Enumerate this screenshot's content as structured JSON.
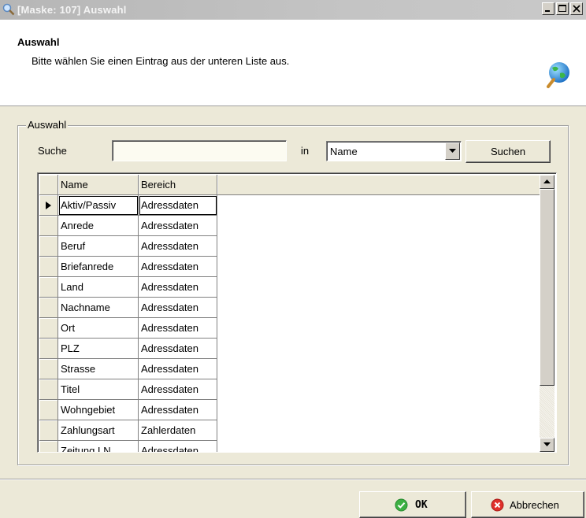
{
  "window": {
    "title": "[Maske: 107]  Auswahl",
    "controls": [
      "minimize-icon",
      "maximize-icon",
      "close-icon"
    ]
  },
  "header": {
    "title": "Auswahl",
    "subtitle": "Bitte wählen Sie einen Eintrag aus der unteren Liste aus.",
    "icon": "globe-search-icon"
  },
  "group": {
    "legend": "Auswahl"
  },
  "search": {
    "label": "Suche",
    "value": "",
    "in_label": "in",
    "field_selected": "Name",
    "button_label": "Suchen"
  },
  "table": {
    "columns": [
      "Name",
      "Bereich"
    ],
    "rows": [
      {
        "name": "Aktiv/Passiv",
        "bereich": "Adressdaten"
      },
      {
        "name": "Anrede",
        "bereich": "Adressdaten"
      },
      {
        "name": "Beruf",
        "bereich": "Adressdaten"
      },
      {
        "name": "Briefanrede",
        "bereich": "Adressdaten"
      },
      {
        "name": "Land",
        "bereich": "Adressdaten"
      },
      {
        "name": "Nachname",
        "bereich": "Adressdaten"
      },
      {
        "name": "Ort",
        "bereich": "Adressdaten"
      },
      {
        "name": "PLZ",
        "bereich": "Adressdaten"
      },
      {
        "name": "Strasse",
        "bereich": "Adressdaten"
      },
      {
        "name": "Titel",
        "bereich": "Adressdaten"
      },
      {
        "name": "Wohngebiet",
        "bereich": "Adressdaten"
      },
      {
        "name": "Zahlungsart",
        "bereich": "Zahlerdaten"
      },
      {
        "name": "Zeitung LN",
        "bereich": "Adressdaten"
      }
    ],
    "selected_row": 0
  },
  "footer": {
    "ok_label": "OK",
    "cancel_label": "Abbrechen"
  },
  "colors": {
    "titlebar": "#c4c4c4",
    "dialog_bg": "#ece9d8",
    "ok_icon": "#3cb043",
    "cancel_icon": "#e0302a"
  }
}
